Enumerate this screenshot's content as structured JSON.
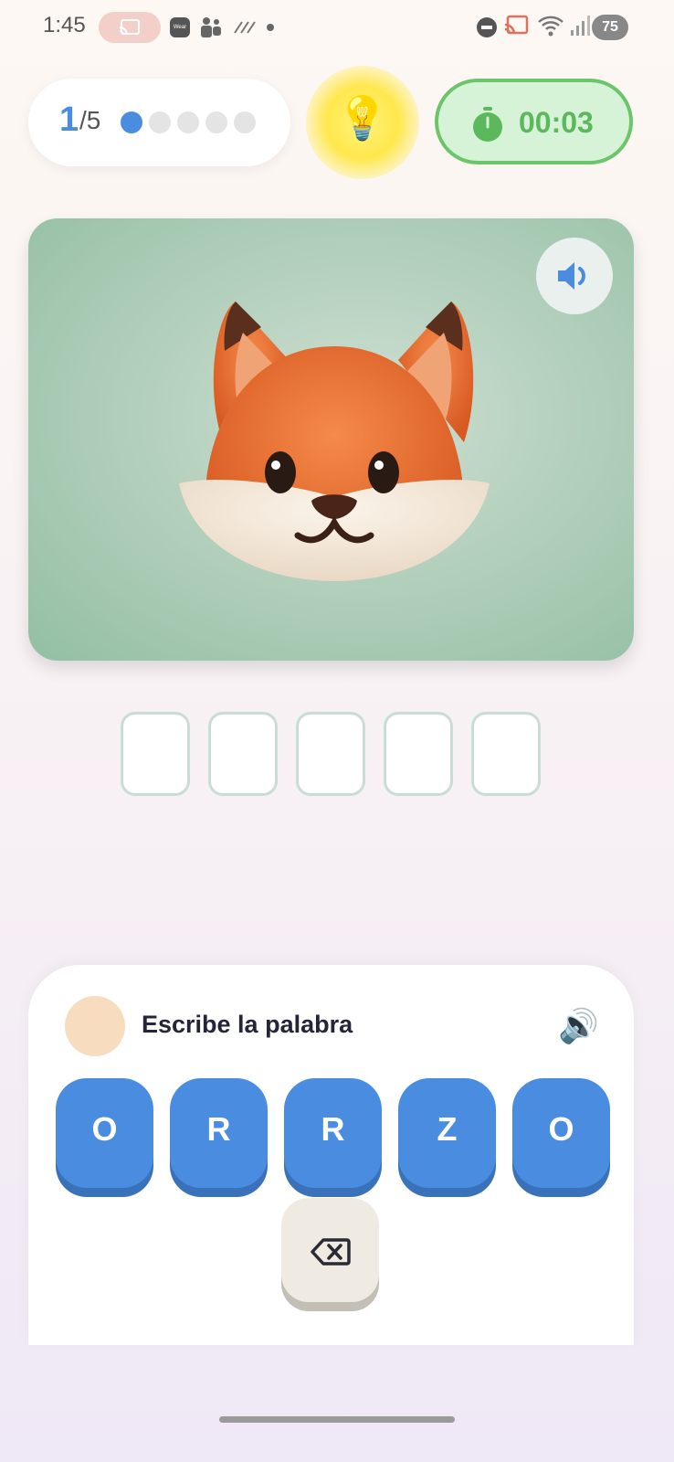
{
  "status_bar": {
    "time": "1:45",
    "wear_label": "Wear",
    "battery": "75"
  },
  "progress": {
    "current": "1",
    "total_label": "/5",
    "total_steps": 5,
    "active_step": 1
  },
  "hint": {
    "emoji": "💡"
  },
  "timer": {
    "value": "00:03",
    "accent": "#5cb85c"
  },
  "image_card": {
    "subject_icon": "fox-face-icon",
    "speaker_icon": "speaker-icon"
  },
  "answer_slots": [
    "",
    "",
    "",
    "",
    ""
  ],
  "panel": {
    "title": "Escribe la palabra",
    "speaker_emoji": "🔊"
  },
  "keyboard": {
    "letters": [
      "O",
      "R",
      "R",
      "Z",
      "O"
    ],
    "key_color": "#4a8de0",
    "backspace_icon": "backspace-icon"
  }
}
